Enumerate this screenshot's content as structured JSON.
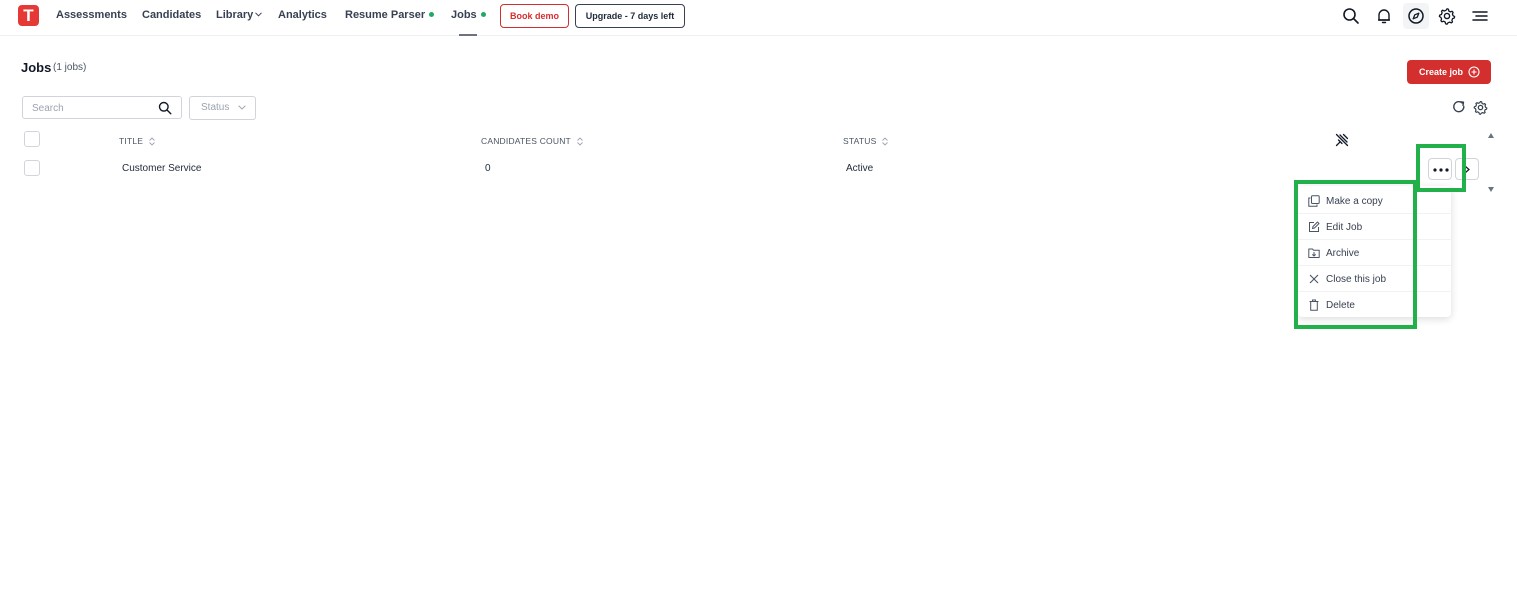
{
  "nav": {
    "logo_letter": "T",
    "items": [
      {
        "label": "Assessments"
      },
      {
        "label": "Candidates"
      },
      {
        "label": "Library"
      },
      {
        "label": "Analytics"
      },
      {
        "label": "Resume Parser"
      },
      {
        "label": "Jobs"
      }
    ],
    "book_demo": "Book demo",
    "upgrade": "Upgrade - 7 days left",
    "icons": [
      "search-icon",
      "bell-icon",
      "compass-icon",
      "gear-icon",
      "menu-icon"
    ]
  },
  "page": {
    "title": "Jobs",
    "count": "(1 jobs)",
    "create_button": "Create job"
  },
  "filters": {
    "search_placeholder": "Search",
    "status_label": "Status"
  },
  "table": {
    "columns": [
      "TITLE",
      "CANDIDATES COUNT",
      "STATUS"
    ],
    "rows": [
      {
        "title": "Customer Service",
        "candidates_count": "0",
        "status": "Active"
      }
    ]
  },
  "menu": {
    "items": [
      {
        "label": "Make a copy",
        "icon": "copy-icon"
      },
      {
        "label": "Edit Job",
        "icon": "edit-icon"
      },
      {
        "label": "Archive",
        "icon": "archive-icon"
      },
      {
        "label": "Close this job",
        "icon": "close-icon"
      },
      {
        "label": "Delete",
        "icon": "trash-icon"
      }
    ]
  },
  "colors": {
    "brand_red": "#d32f2f",
    "active_dot": "#22a865",
    "highlight_green": "#22b04a"
  }
}
